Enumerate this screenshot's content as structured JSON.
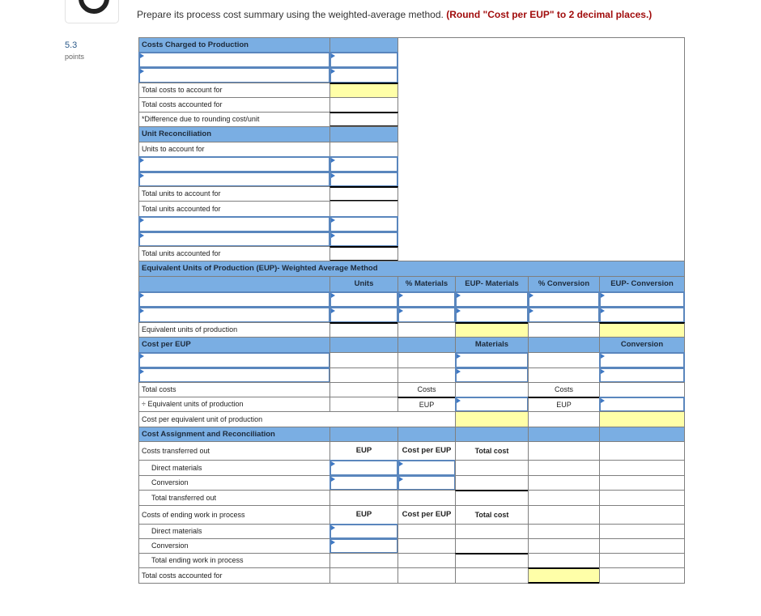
{
  "question": {
    "points_value": "5.3",
    "points_label": "points",
    "prompt_text": "Prepare its process cost summary using the weighted-average method.",
    "prompt_emphasis": "(Round \"Cost per EUP\" to 2 decimal places.)"
  },
  "colors": {
    "header_blue": "#7aaee3",
    "highlight_yellow": "#ffffa8",
    "input_border": "#5a86bd",
    "emphasis_red": "#a10d0d"
  },
  "costs_charged": {
    "header": "Costs Charged to Production",
    "rows": [
      {
        "label": "Total costs to account for"
      },
      {
        "label": "Total costs accounted for"
      },
      {
        "label": "*Difference due to rounding cost/unit"
      }
    ]
  },
  "unit_reconciliation": {
    "header": "Unit Reconciliation",
    "units_to_account_label": "Units to account for",
    "total_units_to_account_label": "Total units to account for",
    "total_units_accounted_label": "Total units accounted for",
    "total_units_accounted_label_2": "Total units accounted for"
  },
  "eup": {
    "header": "Equivalent Units of Production (EUP)- Weighted Average Method",
    "columns": [
      "Units",
      "% Materials",
      "EUP- Materials",
      "% Conversion",
      "EUP- Conversion"
    ],
    "total_label": "Equivalent units of production"
  },
  "cost_per_eup": {
    "header": "Cost per EUP",
    "materials_label": "Materials",
    "conversion_label": "Conversion",
    "total_costs_label": "Total costs",
    "divide_label": "÷ Equivalent units of production",
    "result_label": "Cost per equivalent unit of production",
    "costs_tag": "Costs",
    "eup_tag": "EUP"
  },
  "cost_assignment": {
    "header": "Cost Assignment and Reconciliation",
    "transferred_label": "Costs transferred out",
    "eup_col": "EUP",
    "cost_per_eup_col": "Cost per EUP",
    "total_cost_col": "Total cost",
    "direct_materials_label": "Direct materials",
    "conversion_label": "Conversion",
    "total_transferred_label": "Total transferred out",
    "ending_wip_label": "Costs of ending work in process",
    "total_ending_label": "Total ending work in process",
    "total_accounted_label": "Total costs accounted for"
  },
  "inputs": {
    "value": ""
  }
}
